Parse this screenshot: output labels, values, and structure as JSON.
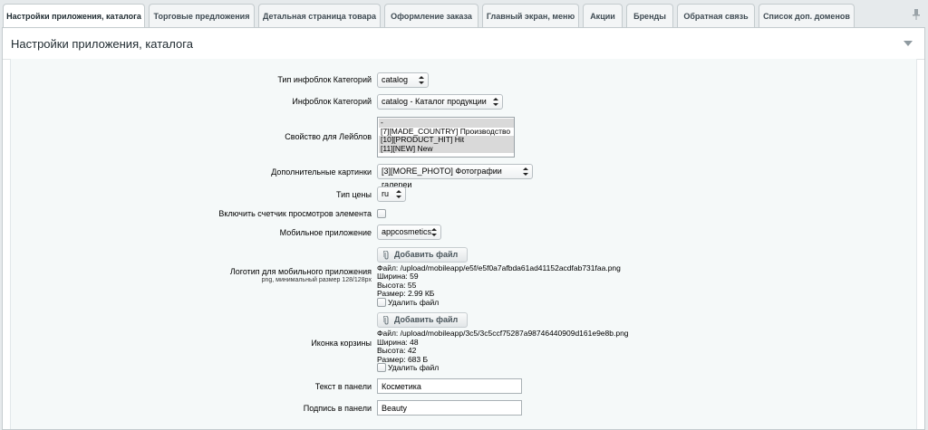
{
  "tabs": [
    {
      "label": "Настройки приложения, каталога",
      "active": true
    },
    {
      "label": "Торговые предложения"
    },
    {
      "label": "Детальная страница товара"
    },
    {
      "label": "Оформление заказа"
    },
    {
      "label": "Главный экран, меню"
    },
    {
      "label": "Акции"
    },
    {
      "label": "Бренды"
    },
    {
      "label": "Обратная связь"
    },
    {
      "label": "Список доп. доменов"
    }
  ],
  "panel": {
    "title": "Настройки приложения, каталога"
  },
  "form": {
    "iblock_type": {
      "label": "Тип инфоблок Категорий",
      "value": "catalog"
    },
    "iblock": {
      "label": "Инфоблок Категорий",
      "value": "catalog - Каталог продукции"
    },
    "labels_property": {
      "label": "Свойство для Лейблов",
      "options": [
        {
          "text": "-",
          "selected": true
        },
        {
          "text": "[7][MADE_COUNTRY] Производство",
          "selected": false
        },
        {
          "text": "[10][PRODUCT_HIT] Hit",
          "selected": true
        },
        {
          "text": "[11][NEW] New",
          "selected": true
        }
      ]
    },
    "extra_pictures": {
      "label": "Дополнительные картинки",
      "value": "[3][MORE_PHOTO] Фотографии галереи"
    },
    "price_type": {
      "label": "Тип цены",
      "value": "ru"
    },
    "view_counter": {
      "label": "Включить счетчик просмотров элемента"
    },
    "mobile_app": {
      "label": "Мобильное приложение",
      "value": "appcosmetics"
    },
    "logo": {
      "label": "Логотип для мобильного приложения",
      "sublabel": "png, минимальный размер 128/128px",
      "button": "Добавить файл",
      "file": "Файл: /upload/mobileapp/e5f/e5f0a7afbda61ad41152acdfab731faa.png",
      "width": "Ширина: 59",
      "height": "Высота: 55",
      "size": "Размер: 2.99 КБ",
      "delete": "Удалить файл"
    },
    "cart_icon": {
      "label": "Иконка корзины",
      "button": "Добавить файл",
      "file": "Файл: /upload/mobileapp/3c5/3c5ccf75287a98746440909d161e9e8b.png",
      "width": "Ширина: 48",
      "height": "Высота: 42",
      "size": "Размер: 683 Б",
      "delete": "Удалить файл"
    },
    "panel_text": {
      "label": "Текст в панели",
      "value": "Косметика"
    },
    "panel_caption": {
      "label": "Подпись в панели",
      "value": "Beauty"
    }
  }
}
